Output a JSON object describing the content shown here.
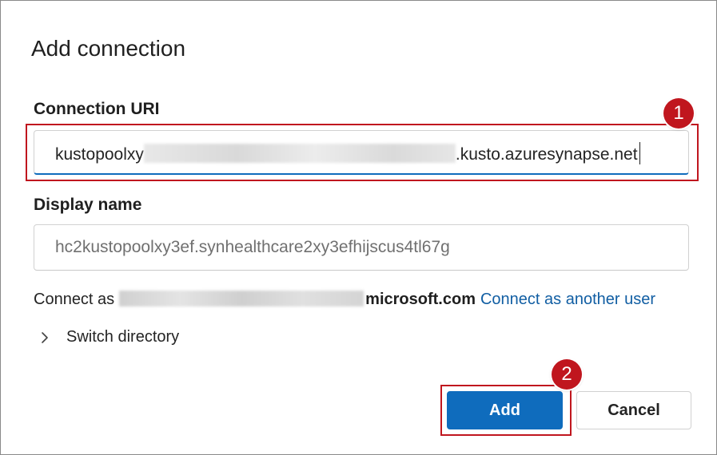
{
  "dialog": {
    "title": "Add connection"
  },
  "connection_uri": {
    "label": "Connection URI",
    "value_prefix": "kustopoolxy",
    "value_suffix": ".kusto.azuresynapse.net"
  },
  "display_name": {
    "label": "Display name",
    "placeholder": "hc2kustopoolxy3ef.synhealthcare2xy3efhijscus4tl67g"
  },
  "account": {
    "connect_as": "Connect as",
    "domain": "microsoft.com",
    "switch_user_link": "Connect as another user"
  },
  "switch_directory": {
    "label": "Switch directory"
  },
  "buttons": {
    "add": "Add",
    "cancel": "Cancel"
  },
  "callouts": {
    "step1": "1",
    "step2": "2"
  },
  "colors": {
    "accent": "#0f6cbd",
    "callout": "#c0161e",
    "link": "#115ea3"
  }
}
